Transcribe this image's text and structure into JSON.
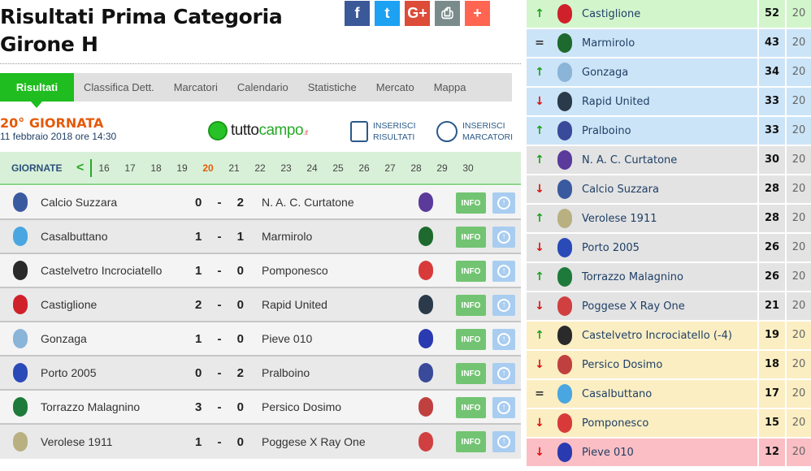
{
  "header": {
    "title_line1": "Risultati Prima Categoria",
    "title_line2": "Girone H"
  },
  "share": [
    {
      "name": "facebook-icon",
      "glyph": "f",
      "color": "#3b5998"
    },
    {
      "name": "twitter-icon",
      "glyph": "t",
      "color": "#1da1f2"
    },
    {
      "name": "google-plus-icon",
      "glyph": "G+",
      "color": "#dd4b39"
    },
    {
      "name": "print-icon",
      "glyph": "⎙",
      "color": "#7a8b8b"
    },
    {
      "name": "more-plus-icon",
      "glyph": "+",
      "color": "#ff6550"
    }
  ],
  "tabs": [
    "Risultati",
    "Classifica Dett.",
    "Marcatori",
    "Calendario",
    "Statistiche",
    "Mercato",
    "Mappa"
  ],
  "giornata": {
    "title": "20° GIORNATA",
    "date": "11 febbraio 2018 ore 14:30"
  },
  "logo": {
    "pre": "tutto",
    "main": "campo",
    "suffix": ".it"
  },
  "insert_results": {
    "line1": "INSERISCI",
    "line2": "RISULTATI"
  },
  "insert_scorers": {
    "line1": "INSERISCI",
    "line2": "MARCATORI"
  },
  "giornate_bar": {
    "label": "GIORNATE",
    "prev": "<",
    "numbers": [
      "16",
      "17",
      "18",
      "19",
      "20",
      "21",
      "22",
      "23",
      "24",
      "25",
      "26",
      "27",
      "28",
      "29",
      "30"
    ],
    "current": "20"
  },
  "matches": [
    {
      "home": "Calcio Suzzara",
      "hs": "0",
      "sep": "-",
      "as": "2",
      "away": "N. A. C. Curtatone",
      "hc": "#3a5aa0",
      "ac": "#5a3a9a"
    },
    {
      "home": "Casalbuttano",
      "hs": "1",
      "sep": "-",
      "as": "1",
      "away": "Marmirolo",
      "hc": "#4aa6e0",
      "ac": "#1e6a2e"
    },
    {
      "home": "Castelvetro Incrociatello",
      "hs": "1",
      "sep": "-",
      "as": "0",
      "away": "Pomponesco",
      "hc": "#2a2a2a",
      "ac": "#d83a3a"
    },
    {
      "home": "Castiglione",
      "hs": "2",
      "sep": "-",
      "as": "0",
      "away": "Rapid United",
      "hc": "#d0202a",
      "ac": "#2a3a4a"
    },
    {
      "home": "Gonzaga",
      "hs": "1",
      "sep": "-",
      "as": "0",
      "away": "Pieve 010",
      "hc": "#8ab4d8",
      "ac": "#2a3ab0"
    },
    {
      "home": "Porto 2005",
      "hs": "0",
      "sep": "-",
      "as": "2",
      "away": "Pralboino",
      "hc": "#2a4ab8",
      "ac": "#3a4a9a"
    },
    {
      "home": "Torrazzo Malagnino",
      "hs": "3",
      "sep": "-",
      "as": "0",
      "away": "Persico Dosimo",
      "hc": "#1e7a3a",
      "ac": "#c04040"
    },
    {
      "home": "Verolese 1911",
      "hs": "1",
      "sep": "-",
      "as": "0",
      "away": "Poggese X Ray One",
      "hc": "#b8b080",
      "ac": "#d04040"
    }
  ],
  "match_buttons": {
    "info": "INFO",
    "up": "↑"
  },
  "standings": [
    {
      "trend": "up",
      "team": "Castiglione",
      "pts": "52",
      "pg": "20",
      "zone": "green",
      "c": "#d0202a"
    },
    {
      "trend": "eq",
      "team": "Marmirolo",
      "pts": "43",
      "pg": "20",
      "zone": "blue",
      "c": "#1e6a2e"
    },
    {
      "trend": "up",
      "team": "Gonzaga",
      "pts": "34",
      "pg": "20",
      "zone": "blue",
      "c": "#8ab4d8"
    },
    {
      "trend": "down",
      "team": "Rapid United",
      "pts": "33",
      "pg": "20",
      "zone": "blue",
      "c": "#2a3a4a"
    },
    {
      "trend": "up",
      "team": "Pralboino",
      "pts": "33",
      "pg": "20",
      "zone": "blue",
      "c": "#3a4a9a"
    },
    {
      "trend": "up",
      "team": "N. A. C. Curtatone",
      "pts": "30",
      "pg": "20",
      "zone": "grey",
      "c": "#5a3a9a"
    },
    {
      "trend": "down",
      "team": "Calcio Suzzara",
      "pts": "28",
      "pg": "20",
      "zone": "grey",
      "c": "#3a5aa0"
    },
    {
      "trend": "up",
      "team": "Verolese 1911",
      "pts": "28",
      "pg": "20",
      "zone": "grey",
      "c": "#b8b080"
    },
    {
      "trend": "down",
      "team": "Porto 2005",
      "pts": "26",
      "pg": "20",
      "zone": "grey",
      "c": "#2a4ab8"
    },
    {
      "trend": "up",
      "team": "Torrazzo Malagnino",
      "pts": "26",
      "pg": "20",
      "zone": "grey",
      "c": "#1e7a3a"
    },
    {
      "trend": "down",
      "team": "Poggese X Ray One",
      "pts": "21",
      "pg": "20",
      "zone": "grey",
      "c": "#d04040"
    },
    {
      "trend": "up",
      "team": "Castelvetro Incrociatello (-4)",
      "pts": "19",
      "pg": "20",
      "zone": "yellow",
      "c": "#2a2a2a"
    },
    {
      "trend": "down",
      "team": "Persico Dosimo",
      "pts": "18",
      "pg": "20",
      "zone": "yellow",
      "c": "#c04040"
    },
    {
      "trend": "eq",
      "team": "Casalbuttano",
      "pts": "17",
      "pg": "20",
      "zone": "yellow",
      "c": "#4aa6e0"
    },
    {
      "trend": "down",
      "team": "Pomponesco",
      "pts": "15",
      "pg": "20",
      "zone": "yellow",
      "c": "#d83a3a"
    },
    {
      "trend": "down",
      "team": "Pieve 010",
      "pts": "12",
      "pg": "20",
      "zone": "red",
      "c": "#2a3ab0"
    }
  ],
  "trend_glyphs": {
    "up": "↑",
    "down": "↓",
    "eq": "="
  }
}
